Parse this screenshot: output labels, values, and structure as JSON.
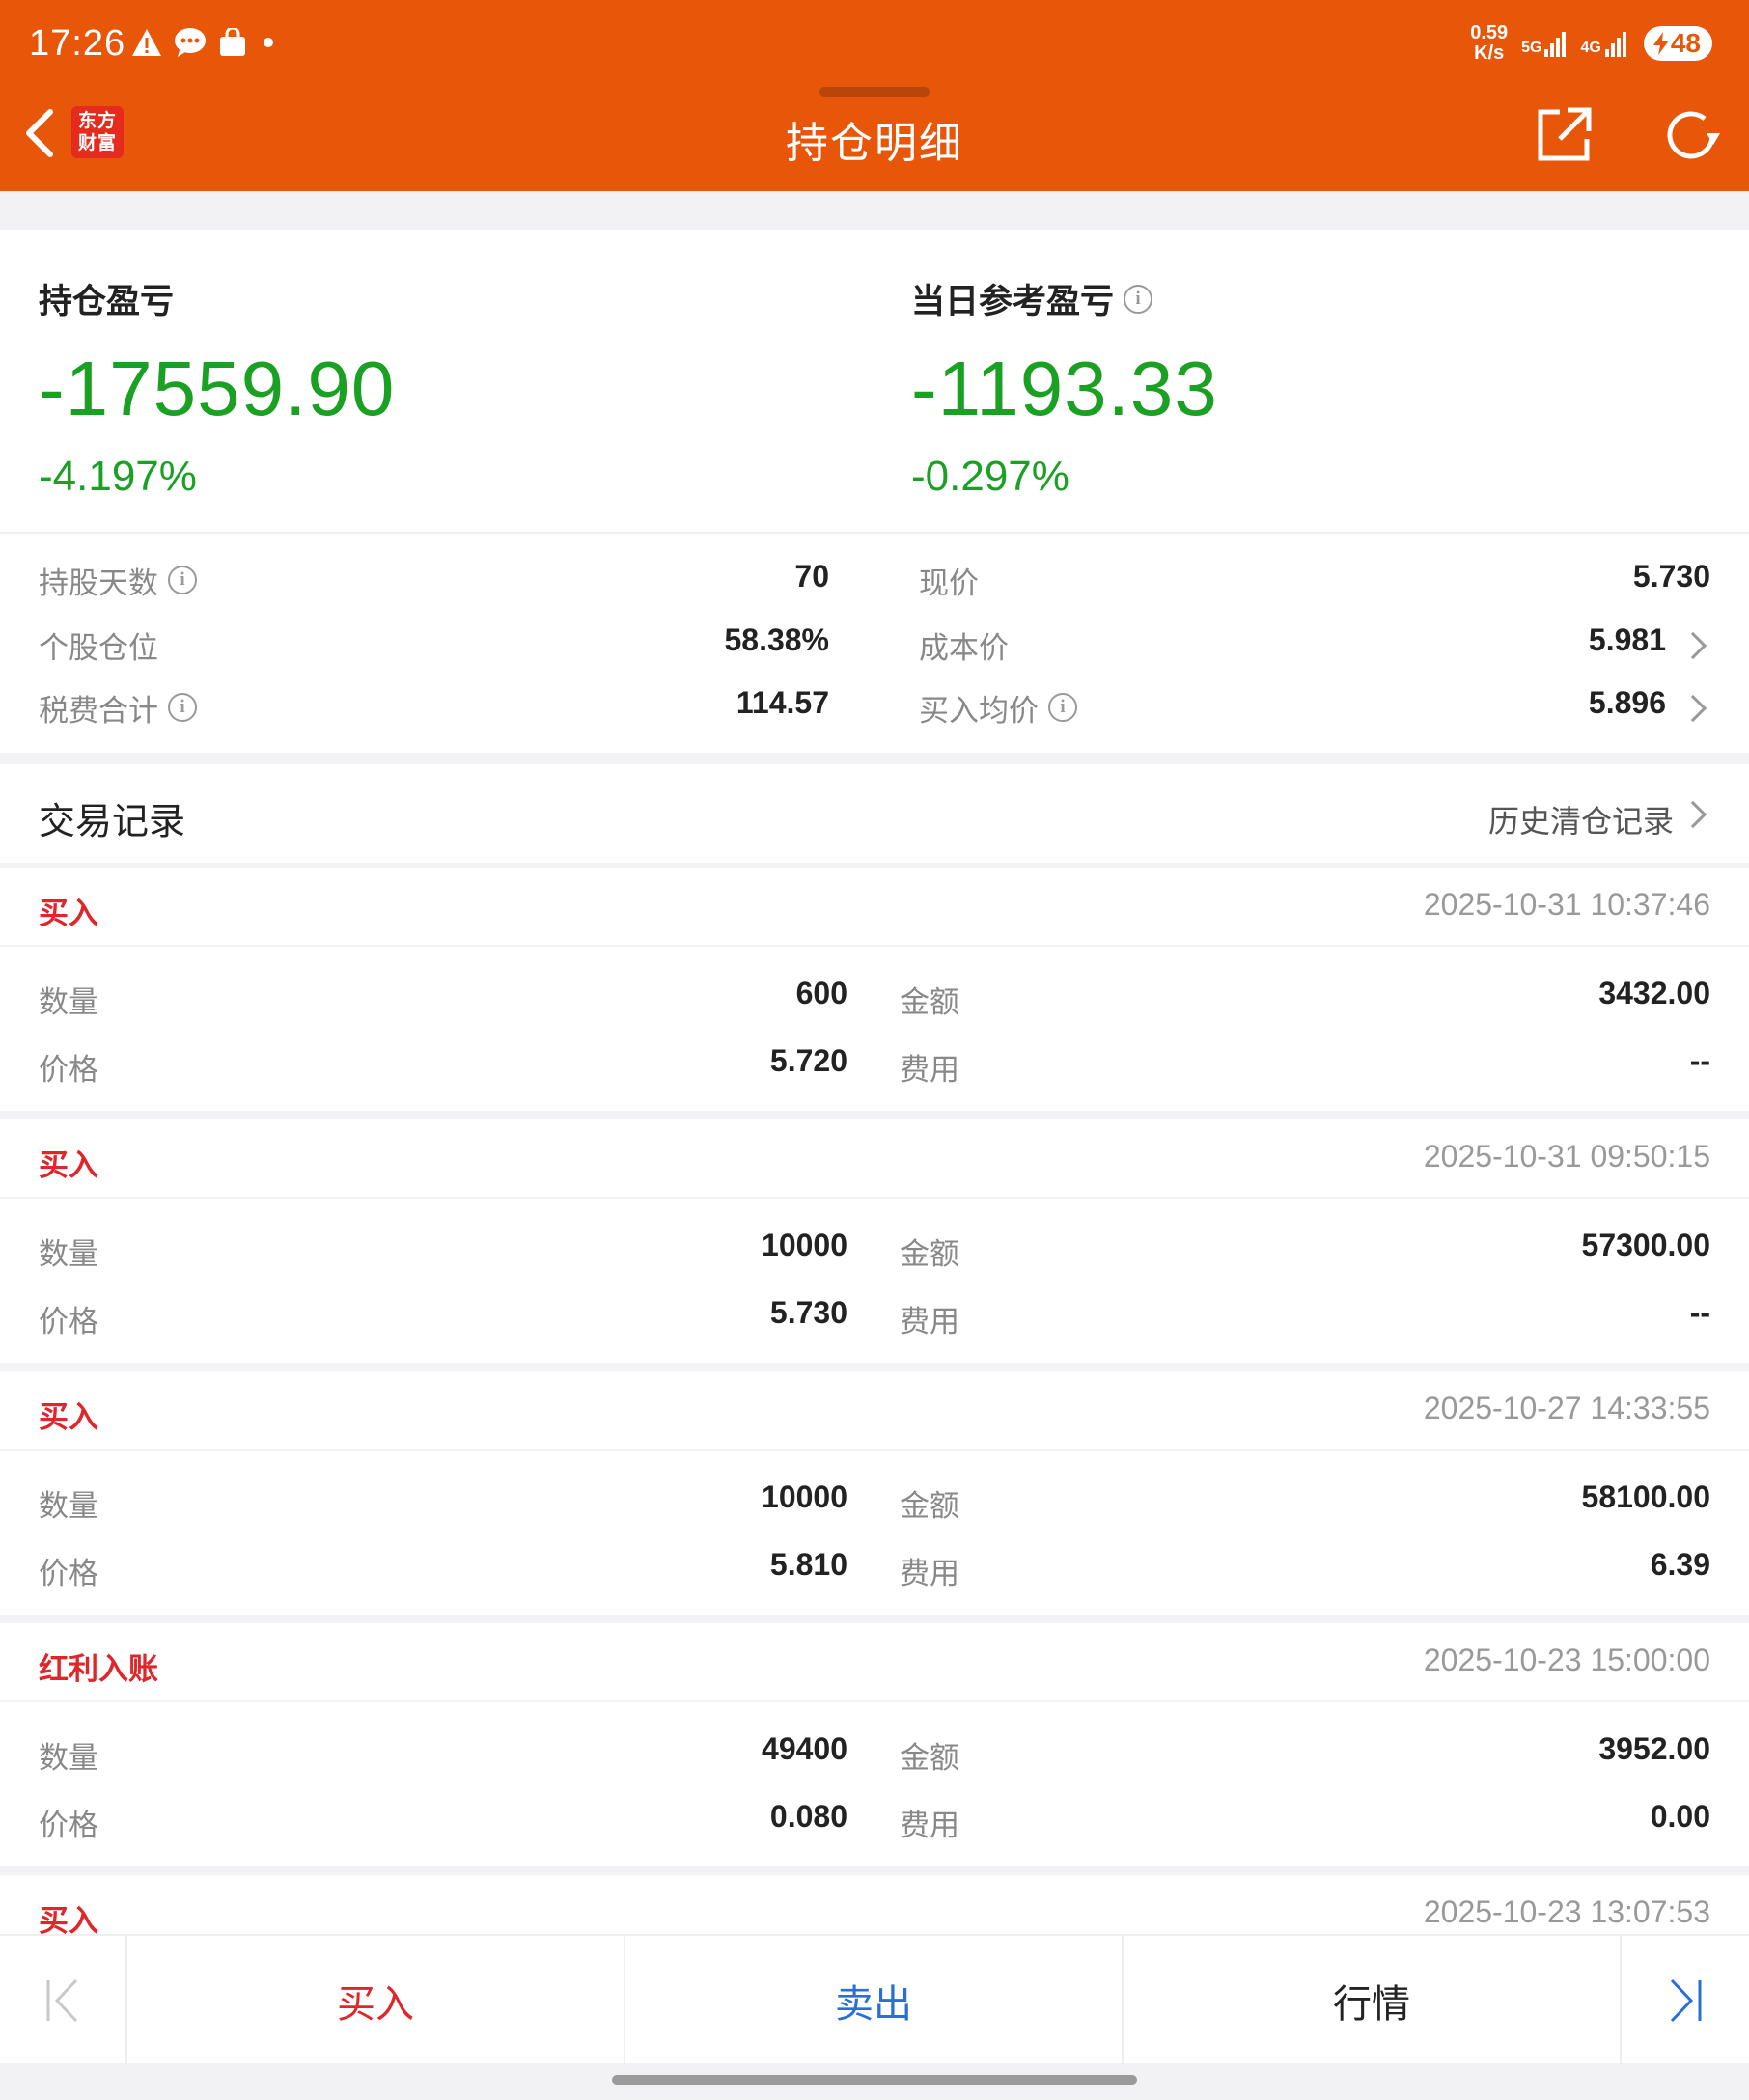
{
  "status_bar": {
    "time": "17:26",
    "net_speed_value": "0.59",
    "net_speed_unit": "K/s",
    "signal_1": "5G",
    "signal_2": "4G",
    "battery": "48"
  },
  "header": {
    "logo_line1": "东方",
    "logo_line2": "财富",
    "title": "持仓明细",
    "accent_color": "#e8560a"
  },
  "summary": {
    "holding_pnl_label": "持仓盈亏",
    "holding_pnl_value": "-17559.90",
    "holding_pnl_pct": "-4.197%",
    "daily_pnl_label": "当日参考盈亏",
    "daily_pnl_value": "-1193.33",
    "daily_pnl_pct": "-0.297%"
  },
  "stats": {
    "days_label": "持股天数",
    "days_value": "70",
    "position_label": "个股仓位",
    "position_value": "58.38%",
    "tax_label": "税费合计",
    "tax_value": "114.57",
    "price_label": "现价",
    "price_value": "5.730",
    "cost_label": "成本价",
    "cost_value": "5.981",
    "avg_buy_label": "买入均价",
    "avg_buy_value": "5.896"
  },
  "transactions": {
    "title": "交易记录",
    "history_link": "历史清仓记录",
    "labels": {
      "qty": "数量",
      "price": "价格",
      "amount": "金额",
      "fee": "费用"
    },
    "records": [
      {
        "type": "买入",
        "time": "2025-10-31 10:37:46",
        "qty": "600",
        "price": "5.720",
        "amount": "3432.00",
        "fee": "--"
      },
      {
        "type": "买入",
        "time": "2025-10-31 09:50:15",
        "qty": "10000",
        "price": "5.730",
        "amount": "57300.00",
        "fee": "--"
      },
      {
        "type": "买入",
        "time": "2025-10-27 14:33:55",
        "qty": "10000",
        "price": "5.810",
        "amount": "58100.00",
        "fee": "6.39"
      },
      {
        "type": "红利入账",
        "time": "2025-10-23 15:00:00",
        "qty": "49400",
        "price": "0.080",
        "amount": "3952.00",
        "fee": "0.00"
      },
      {
        "type": "买入",
        "time": "2025-10-23 13:07:53"
      }
    ]
  },
  "bottom_bar": {
    "buy": "买入",
    "sell": "卖出",
    "market": "行情"
  },
  "colors": {
    "loss_green": "#1aa023",
    "buy_red": "#e0262b",
    "sell_blue": "#2a6fd6"
  }
}
